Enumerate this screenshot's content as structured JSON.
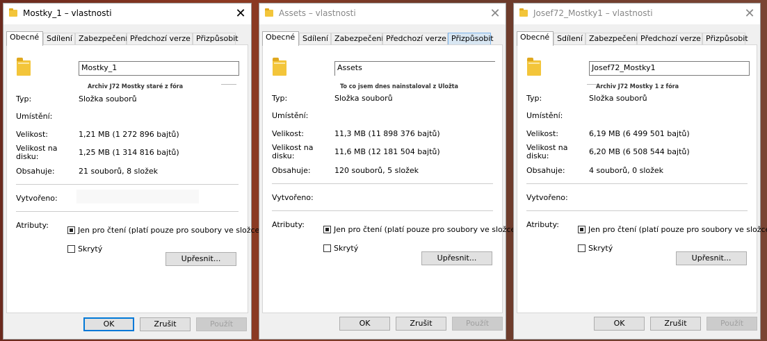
{
  "windows": [
    {
      "title": "Mostky_1 – vlastnosti",
      "state": "active",
      "tabs": [
        "Obecné",
        "Sdílení",
        "Zabezpečení",
        "Předchozí verze",
        "Přizpůsobit"
      ],
      "name_value": "Mostky_1",
      "overlay_text": "Archiv J72 Mostky staré z fóra",
      "type_label": "Typ:",
      "type_value": "Složka souborů",
      "location_label": "Umístění:",
      "location_value": "",
      "size_label": "Velikost:",
      "size_value": "1,21 MB (1 272 896 bajtů)",
      "disk_label": "Velikost na disku:",
      "disk_value": "1,25 MB (1 314 816 bajtů)",
      "contains_label": "Obsahuje:",
      "contains_value": "21 souborů, 8 složek",
      "created_label": "Vytvořeno:",
      "created_value": "",
      "attributes_label": "Atributy:",
      "readonly_label": "Jen pro čtení (platí pouze pro soubory ve složce)",
      "readonly_checked": true,
      "hidden_label": "Skrytý",
      "hidden_checked": false,
      "advanced_label": "Upřesnit...",
      "ok_label": "OK",
      "cancel_label": "Zrušit",
      "apply_label": "Použít"
    },
    {
      "title": "Assets – vlastnosti",
      "state": "inactive",
      "tabs": [
        "Obecné",
        "Sdílení",
        "Zabezpečení",
        "Předchozí verze",
        "Přizpůsobit"
      ],
      "name_value": "Assets",
      "overlay_text": "To co jsem dnes nainstaloval z Uložta",
      "type_label": "Typ:",
      "type_value": "Složka souborů",
      "location_label": "Umístění:",
      "location_value": "",
      "size_label": "Velikost:",
      "size_value": "11,3 MB (11 898 376 bajtů)",
      "disk_label": "Velikost na disku:",
      "disk_value": "11,6 MB (12 181 504 bajtů)",
      "contains_label": "Obsahuje:",
      "contains_value": "120 souborů, 5 složek",
      "created_label": "Vytvořeno:",
      "created_value": "",
      "attributes_label": "Atributy:",
      "readonly_label": "Jen pro čtení (platí pouze pro soubory ve složce)",
      "readonly_checked": true,
      "hidden_label": "Skrytý",
      "hidden_checked": false,
      "advanced_label": "Upřesnit...",
      "ok_label": "OK",
      "cancel_label": "Zrušit",
      "apply_label": "Použít"
    },
    {
      "title": "Josef72_Mostky1 – vlastnosti",
      "state": "inactive",
      "tabs": [
        "Obecné",
        "Sdílení",
        "Zabezpečení",
        "Předchozí verze",
        "Přizpůsobit"
      ],
      "name_value": "Josef72_Mostky1",
      "overlay_text": "Archiv J72 Mostky 1 z fóra",
      "type_label": "Typ:",
      "type_value": "Složka souborů",
      "location_label": "Umístění:",
      "location_value": "",
      "size_label": "Velikost:",
      "size_value": "6,19 MB (6 499 501 bajtů)",
      "disk_label": "Velikost na disku:",
      "disk_value": "6,20 MB (6 508 544 bajtů)",
      "contains_label": "Obsahuje:",
      "contains_value": "4 souborů, 0 složek",
      "created_label": "Vytvořeno:",
      "created_value": "",
      "attributes_label": "Atributy:",
      "readonly_label": "Jen pro čtení (platí pouze pro soubory ve složce)",
      "readonly_checked": true,
      "hidden_label": "Skrytý",
      "hidden_checked": false,
      "advanced_label": "Upřesnit...",
      "ok_label": "OK",
      "cancel_label": "Zrušit",
      "apply_label": "Použít"
    }
  ],
  "colors": {
    "accent": "#0078d7",
    "folder": "#f3c53a",
    "tab_hover": "#d8e6f2"
  }
}
